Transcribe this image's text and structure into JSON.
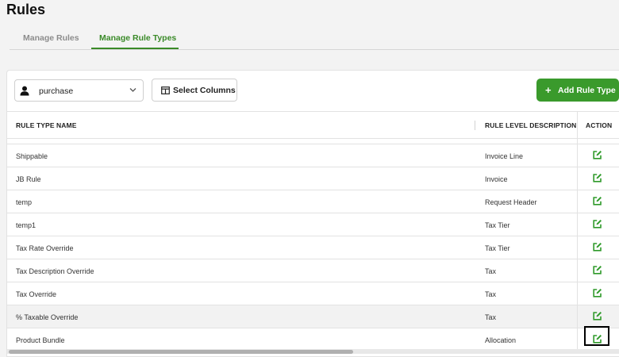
{
  "page": {
    "title": "Rules"
  },
  "tabs": [
    {
      "label": "Manage Rules",
      "active": false
    },
    {
      "label": "Manage Rule Types",
      "active": true
    }
  ],
  "toolbar": {
    "user_select": {
      "value": "purchase",
      "icon": "person-icon"
    },
    "select_columns_label": "Select Columns",
    "add_rule_type_label": "Add Rule Type"
  },
  "table": {
    "columns": {
      "name": "RULE TYPE NAME",
      "level": "RULE LEVEL DESCRIPTION",
      "action": "ACTION"
    },
    "rows": [
      {
        "name": "Shippable",
        "level": "Invoice Line"
      },
      {
        "name": "JB Rule",
        "level": "Invoice"
      },
      {
        "name": "temp",
        "level": "Request Header"
      },
      {
        "name": "temp1",
        "level": "Tax Tier"
      },
      {
        "name": "Tax Rate Override",
        "level": "Tax Tier"
      },
      {
        "name": "Tax Description Override",
        "level": "Tax"
      },
      {
        "name": "Tax Override",
        "level": "Tax"
      },
      {
        "name": "% Taxable Override",
        "level": "Tax"
      },
      {
        "name": "Product Bundle",
        "level": "Allocation"
      }
    ]
  },
  "colors": {
    "accent_green": "#3a9a2c",
    "active_tab_green": "#3a8a28",
    "edit_icon_green": "#2f9a2a"
  }
}
